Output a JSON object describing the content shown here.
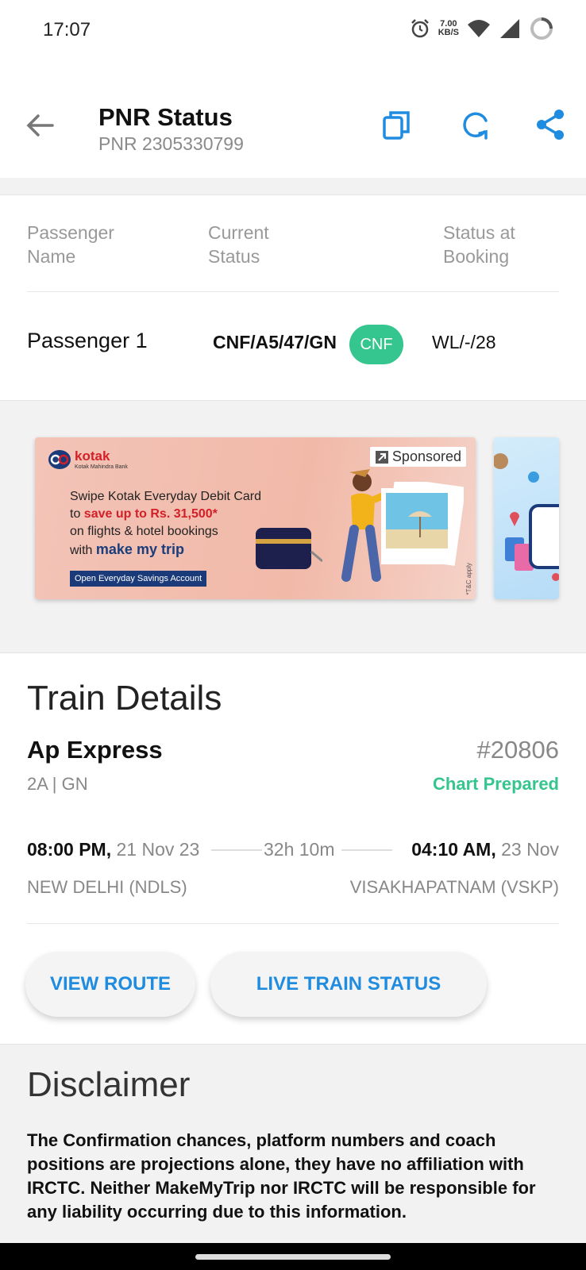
{
  "status_bar": {
    "time": "17:07",
    "speed_value": "7.00",
    "speed_unit": "KB/S"
  },
  "header": {
    "title": "PNR Status",
    "subtitle": "PNR 2305330799"
  },
  "passenger_table": {
    "col1_line1": "Passenger",
    "col1_line2": "Name",
    "col2_line1": "Current",
    "col2_line2": "Status",
    "col3_line1": "Status at",
    "col3_line2": "Booking",
    "rows": [
      {
        "name": "Passenger 1",
        "current": "CNF/A5/47/GN",
        "badge": "CNF",
        "booking": "WL/-/28"
      }
    ]
  },
  "ad": {
    "brand": "kotak",
    "brand_sub": "Kotak Mahindra Bank",
    "sponsored": "Sponsored",
    "line1": "Swipe Kotak Everyday Debit Card",
    "line2_pre": "to ",
    "line2_highlight": "save up to Rs. 31,500*",
    "line3": "on flights & hotel bookings",
    "line4_pre": "with ",
    "line4_brand": "make my trip",
    "cta": "Open Everyday Savings Account",
    "tnc": "*T&C apply"
  },
  "train": {
    "section_title": "Train Details",
    "name": "Ap Express",
    "number": "#20806",
    "class_quota": "2A | GN",
    "chart_status": "Chart Prepared",
    "dep_time": "08:00 PM,",
    "dep_date": "21 Nov 23",
    "duration": "32h 10m",
    "arr_time": "04:10 AM,",
    "arr_date": "23 Nov",
    "from": "NEW DELHI (NDLS)",
    "to": "VISAKHAPATNAM (VSKP)",
    "view_route": "VIEW ROUTE",
    "live_status": "LIVE TRAIN STATUS"
  },
  "disclaimer": {
    "title": "Disclaimer",
    "text": "The Confirmation chances, platform numbers and coach positions are projections alone, they have no affiliation with IRCTC. Neither MakeMyTrip nor IRCTC will be responsible for any liability occurring due to this information."
  },
  "colors": {
    "accent": "#1f8ce0",
    "success": "#35c58e"
  }
}
